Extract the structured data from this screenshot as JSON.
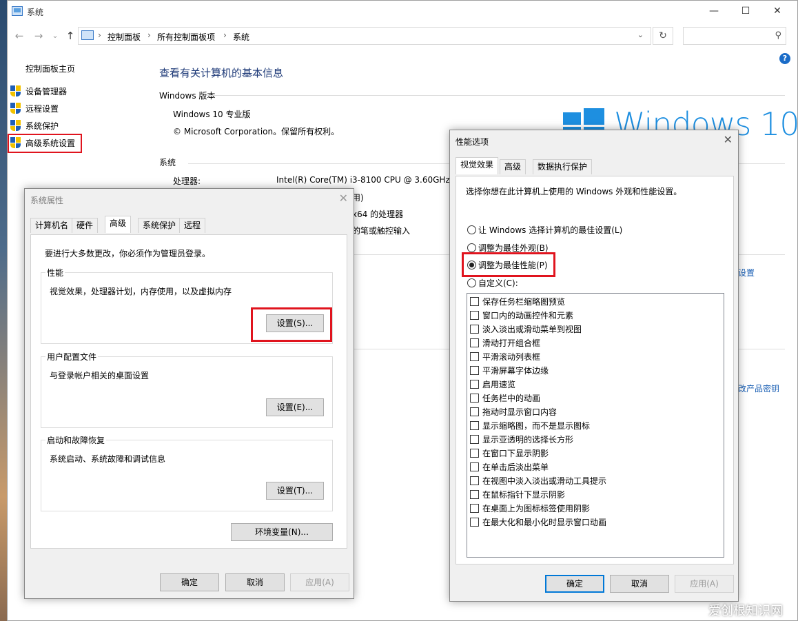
{
  "system_window": {
    "title": "系统",
    "controls": {
      "minimize": "—",
      "maximize": "☐",
      "close": "✕"
    },
    "breadcrumbs": [
      "控制面板",
      "所有控制面板项",
      "系统"
    ],
    "search_placeholder": "",
    "left_nav": {
      "home": "控制面板主页",
      "items": [
        "设备管理器",
        "远程设置",
        "系统保护",
        "高级系统设置"
      ]
    },
    "heading": "查看有关计算机的基本信息",
    "windows_edition": {
      "section": "Windows 版本",
      "edition": "Windows 10 专业版",
      "copyright": "© Microsoft Corporation。保留所有权利。",
      "brand": "Windows 10"
    },
    "system": {
      "section": "系统",
      "processor_label": "处理器:",
      "processor_value": "Intel(R) Core(TM) i3-8100 CPU @ 3.60GHz",
      "partial_1": "用)",
      "partial_2": "x64 的处理器",
      "partial_3": "的笔或触控输入"
    },
    "right_links": {
      "settings_partial": "设置",
      "product_key_partial": "改产品密钥"
    }
  },
  "system_properties": {
    "title": "系统属性",
    "tabs": [
      "计算机名",
      "硬件",
      "高级",
      "系统保护",
      "远程"
    ],
    "admin_note": "要进行大多数更改，你必须作为管理员登录。",
    "performance": {
      "label": "性能",
      "desc": "视觉效果，处理器计划，内存使用，以及虚拟内存",
      "button": "设置(S)..."
    },
    "user_profiles": {
      "label": "用户配置文件",
      "desc": "与登录帐户相关的桌面设置",
      "button": "设置(E)..."
    },
    "startup": {
      "label": "启动和故障恢复",
      "desc": "系统启动、系统故障和调试信息",
      "button": "设置(T)..."
    },
    "env_button": "环境变量(N)...",
    "ok": "确定",
    "cancel": "取消",
    "apply": "应用(A)"
  },
  "performance_options": {
    "title": "性能选项",
    "tabs": [
      "视觉效果",
      "高级",
      "数据执行保护"
    ],
    "intro": "选择你想在此计算机上使用的 Windows 外观和性能设置。",
    "radios": [
      {
        "label": "让 Windows 选择计算机的最佳设置(L)",
        "checked": false
      },
      {
        "label": "调整为最佳外观(B)",
        "checked": false
      },
      {
        "label": "调整为最佳性能(P)",
        "checked": true
      },
      {
        "label": "自定义(C):",
        "checked": false
      }
    ],
    "effects": [
      "保存任务栏缩略图预览",
      "窗口内的动画控件和元素",
      "淡入淡出或滑动菜单到视图",
      "滑动打开组合框",
      "平滑滚动列表框",
      "平滑屏幕字体边缘",
      "启用速览",
      "任务栏中的动画",
      "拖动时显示窗口内容",
      "显示缩略图，而不是显示图标",
      "显示亚透明的选择长方形",
      "在窗口下显示阴影",
      "在单击后淡出菜单",
      "在视图中淡入淡出或滑动工具提示",
      "在鼠标指针下显示阴影",
      "在桌面上为图标标签使用阴影",
      "在最大化和最小化时显示窗口动画"
    ],
    "ok": "确定",
    "cancel": "取消",
    "apply": "应用(A)"
  },
  "watermark": "爱创根知识网",
  "colors": {
    "highlight": "#e0141e",
    "link": "#1a5fb4",
    "heading": "#1e3a78",
    "brand": "#1e8fe0"
  }
}
